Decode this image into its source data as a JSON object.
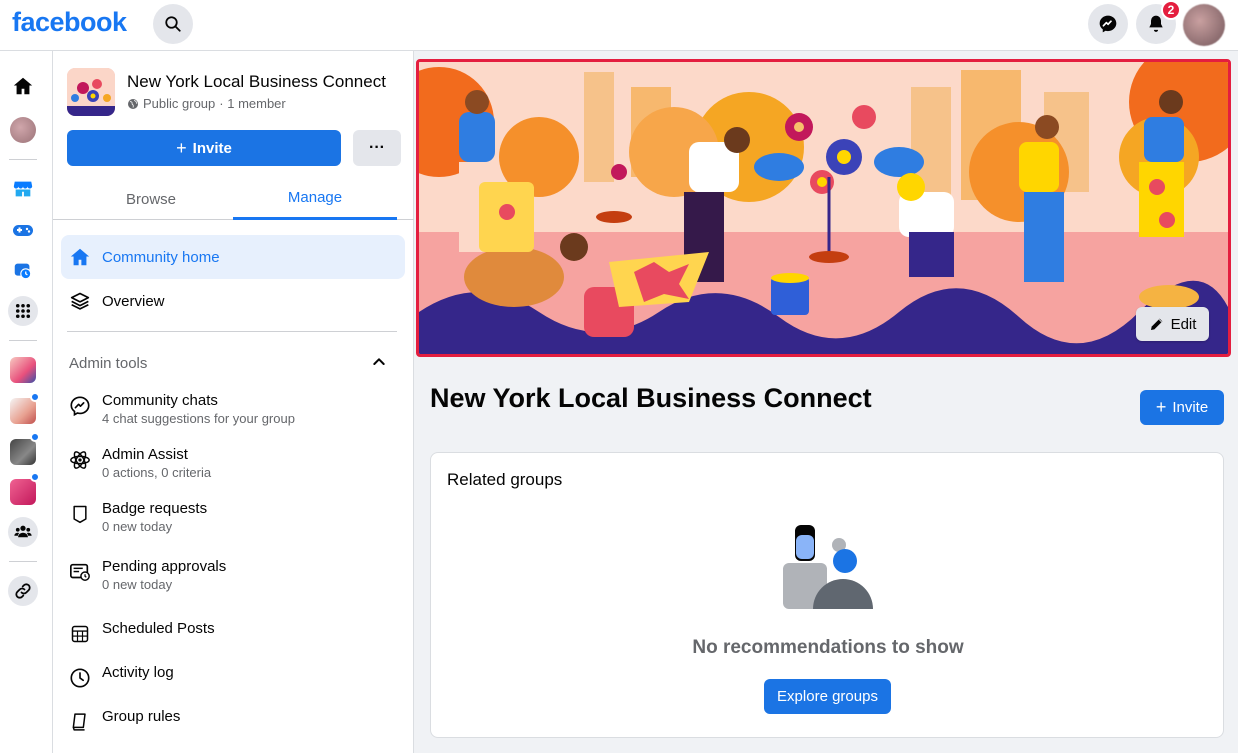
{
  "brand": {
    "logo": "facebook",
    "accent": "#1877f2"
  },
  "topbar": {
    "notifications_count": "2"
  },
  "group": {
    "name": "New York Local Business Connect",
    "privacy": "Public group",
    "members": "· 1 member"
  },
  "side": {
    "invite_label": "Invite",
    "more_label": "···",
    "tabs": [
      {
        "label": "Browse"
      },
      {
        "label": "Manage"
      }
    ],
    "nav": [
      {
        "label": "Community home"
      },
      {
        "label": "Overview"
      }
    ],
    "admin_tools_label": "Admin tools",
    "tools": [
      {
        "title": "Community chats",
        "subtitle": "4 chat suggestions for your group"
      },
      {
        "title": "Admin Assist",
        "subtitle": "0 actions, 0 criteria"
      },
      {
        "title": "Badge requests",
        "subtitle": "0 new today"
      },
      {
        "title": "Pending approvals",
        "subtitle": "0 new today"
      },
      {
        "title": "Scheduled Posts",
        "subtitle": ""
      },
      {
        "title": "Activity log",
        "subtitle": ""
      },
      {
        "title": "Group rules",
        "subtitle": ""
      }
    ]
  },
  "main": {
    "edit_label": "Edit",
    "title": "New York Local Business Connect",
    "invite_label": "Invite",
    "related": {
      "title": "Related groups",
      "empty_text": "No recommendations to show",
      "explore_label": "Explore groups"
    }
  }
}
